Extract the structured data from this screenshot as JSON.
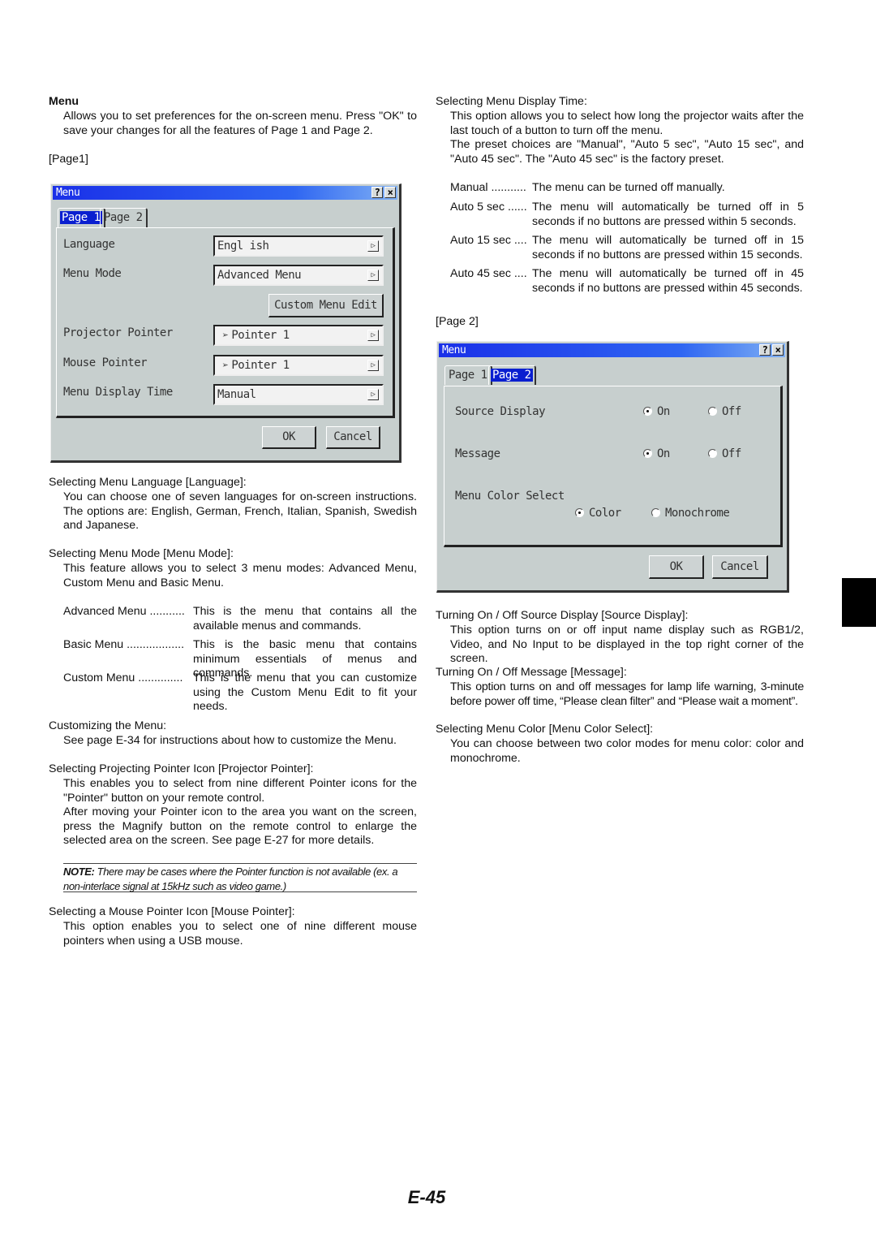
{
  "left": {
    "menu_heading": "Menu",
    "menu_text": "Allows you to set preferences for the on-screen menu. Press \"OK\" to save your changes for all the features of Page 1 and Page 2.",
    "page1_label": "[Page1]",
    "lang_heading": "Selecting Menu Language [Language]:",
    "lang_text": "You can choose one of seven languages for on-screen instructions. The options are: English, German, French, Italian, Spanish, Swedish and Japanese.",
    "mode_heading": "Selecting Menu Mode [Menu Mode]:",
    "mode_text": "This feature allows you to select 3 menu modes: Advanced Menu, Custom Menu and Basic Menu.",
    "modes": [
      {
        "term": "Advanced Menu ...........",
        "desc": "This is the menu that contains all the available menus and commands."
      },
      {
        "term": "Basic Menu ..................",
        "desc": "This is the basic menu that contains minimum essentials of menus and commands."
      },
      {
        "term": "Custom Menu ..............",
        "desc": "This is the menu that you can customize using the Custom Menu Edit to fit your needs."
      }
    ],
    "custom_heading": "Customizing the Menu:",
    "custom_text": "See page E-34 for instructions about how to customize the Menu.",
    "proj_heading": "Selecting Projecting Pointer Icon [Projector Pointer]:",
    "proj_text1": "This enables you to select from nine different Pointer icons for the \"Pointer\" button on your remote control.",
    "proj_text2": "After moving your Pointer icon to the area you want on the screen, press the Magnify button on the remote control to enlarge the selected area on the screen. See page E-27 for more details.",
    "note_label": "NOTE:",
    "note_text": " There may be cases where the Pointer function is not available (ex. a non-interlace signal at 15kHz such as video game.)",
    "mouse_heading": "Selecting a Mouse Pointer Icon [Mouse Pointer]:",
    "mouse_text": "This option enables you to select one of nine different mouse pointers when using a USB mouse."
  },
  "right": {
    "time_heading": "Selecting Menu Display Time:",
    "time_text1": "This option allows you to select how long the projector waits after the last touch of a button to turn off the menu.",
    "time_text2": "The preset choices are \"Manual\", \"Auto 5 sec\", \"Auto 15 sec\", and \"Auto 45 sec\". The \"Auto 45 sec\" is the factory preset.",
    "times": [
      {
        "term": "Manual ...........",
        "desc": "The menu can be turned off manually."
      },
      {
        "term": "Auto 5 sec ......",
        "desc": "The menu will automatically be turned off in 5 seconds if no buttons are pressed within 5 seconds."
      },
      {
        "term": "Auto 15 sec ....",
        "desc": "The menu will automatically be turned off in 15 seconds if no buttons are pressed within 15 seconds."
      },
      {
        "term": "Auto 45 sec ....",
        "desc": "The menu will automatically be turned off in 45 seconds if no buttons are pressed within 45 seconds."
      }
    ],
    "page2_label": "[Page 2]",
    "src_heading": "Turning On / Off Source Display [Source Display]:",
    "src_text": "This option turns on or off input name display such as RGB1/2, Video, and No Input to be displayed in the top right corner of the screen.",
    "msg_heading": "Turning On / Off Message [Message]:",
    "msg_text": "This option turns on and off messages for lamp life warning, 3-minute before power off time, “Please clean filter” and “Please wait a moment”.",
    "color_heading": "Selecting Menu Color [Menu Color Select]:",
    "color_text": "You can choose between two color modes for menu color: color and monochrome."
  },
  "dialog1": {
    "title": "Menu",
    "help": "?",
    "close": "×",
    "tabs": [
      "Page 1",
      "Page 2"
    ],
    "selected_tab": "Page 1",
    "language_label": "Language",
    "language_value": "Engl ish",
    "mode_label": "Menu Mode",
    "mode_value": "Advanced Menu",
    "custom_edit": "Custom Menu Edit",
    "proj_label": "Projector Pointer",
    "proj_value": "Pointer 1",
    "mouse_label": "Mouse Pointer",
    "mouse_value": "Pointer 1",
    "time_label": "Menu Display Time",
    "time_value": "Manual",
    "arrow": "▷",
    "ok": "OK",
    "cancel": "Cancel"
  },
  "dialog2": {
    "title": "Menu",
    "help": "?",
    "close": "×",
    "tabs": [
      "Page 1",
      "Page 2"
    ],
    "selected_tab": "Page 2",
    "source_label": "Source Display",
    "source_value": "On",
    "message_label": "Message",
    "message_value": "On",
    "color_label": "Menu Color Select",
    "color_value": "Color",
    "on": "On",
    "off": "Off",
    "color": "Color",
    "mono": "Monochrome",
    "ok": "OK",
    "cancel": "Cancel"
  },
  "page_number": "E-45",
  "colors": {
    "titlebar": "#1a30e8",
    "dialog_bg": "#c7cfce",
    "side_tab": "#000000"
  }
}
